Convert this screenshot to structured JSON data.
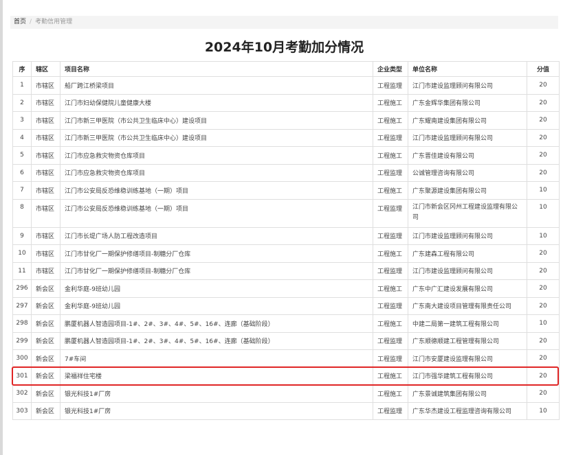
{
  "breadcrumb": {
    "home": "首页",
    "separator": "/",
    "current": "考勤信用管理"
  },
  "title": "2024年10月考勤加分情况",
  "table": {
    "headers": {
      "no": "序",
      "district": "辖区",
      "project": "项目名称",
      "type": "企业类型",
      "unit": "单位名称",
      "score": "分值"
    },
    "rows": [
      {
        "no": "1",
        "district": "市辖区",
        "project": "船厂跨江桥梁项目",
        "type": "工程监理",
        "unit": "江门市建设监理顾问有限公司",
        "score": "20"
      },
      {
        "no": "2",
        "district": "市辖区",
        "project": "江门市妇幼保健院儿童健康大楼",
        "type": "工程施工",
        "unit": "广东金辉华集团有限公司",
        "score": "20"
      },
      {
        "no": "3",
        "district": "市辖区",
        "project": "江门市新三甲医院（市公共卫生临床中心）建设项目",
        "type": "工程施工",
        "unit": "广东耀南建设集团有限公司",
        "score": "20"
      },
      {
        "no": "4",
        "district": "市辖区",
        "project": "江门市新三甲医院（市公共卫生临床中心）建设项目",
        "type": "工程监理",
        "unit": "江门市建设监理顾问有限公司",
        "score": "20"
      },
      {
        "no": "5",
        "district": "市辖区",
        "project": "江门市应急救灾物资仓库项目",
        "type": "工程施工",
        "unit": "广东晋佳建设有限公司",
        "score": "20"
      },
      {
        "no": "6",
        "district": "市辖区",
        "project": "江门市应急救灾物资仓库项目",
        "type": "工程监理",
        "unit": "公诚管理咨询有限公司",
        "score": "20"
      },
      {
        "no": "7",
        "district": "市辖区",
        "project": "江门市公安局反恐维稳训练基地（一期）项目",
        "type": "工程施工",
        "unit": "广东聚源建设集团有限公司",
        "score": "10"
      },
      {
        "no": "8",
        "district": "市辖区",
        "project": "江门市公安局反恐维稳训练基地（一期）项目",
        "type": "工程监理",
        "unit": "江门市新会区冈州工程建设监理有限公司",
        "score": "10"
      },
      {
        "no": "9",
        "district": "市辖区",
        "project": "江门市长堤广场人防工程改造项目",
        "type": "工程监理",
        "unit": "江门市建设监理顾问有限公司",
        "score": "10"
      },
      {
        "no": "10",
        "district": "市辖区",
        "project": "江门市甘化厂一期保护修缮项目-制糖分厂仓库",
        "type": "工程施工",
        "unit": "广东建森工程有限公司",
        "score": "20"
      },
      {
        "no": "11",
        "district": "市辖区",
        "project": "江门市甘化厂一期保护修缮项目-制糖分厂仓库",
        "type": "工程监理",
        "unit": "江门市建设监理顾问有限公司",
        "score": "20"
      },
      {
        "no": "296",
        "district": "新会区",
        "project": "金利华庭-9班幼儿园",
        "type": "工程施工",
        "unit": "广东中广汇建设发展有限公司",
        "score": "20"
      },
      {
        "no": "297",
        "district": "新会区",
        "project": "金利华庭-9班幼儿园",
        "type": "工程监理",
        "unit": "广东南大建设项目管理有限责任公司",
        "score": "20"
      },
      {
        "no": "298",
        "district": "新会区",
        "project": "鹏厦机器人智造园项目-1#、2#、3#、4#、5#、16#、连廊（基础阶段）",
        "type": "工程施工",
        "unit": "中建二局第一建筑工程有限公司",
        "score": "10"
      },
      {
        "no": "299",
        "district": "新会区",
        "project": "鹏厦机器人智造园项目-1#、2#、3#、4#、5#、16#、连廊（基础阶段）",
        "type": "工程监理",
        "unit": "广东顺德顺建工程管理有限公司",
        "score": "20"
      },
      {
        "no": "300",
        "district": "新会区",
        "project": "7#车间",
        "type": "工程监理",
        "unit": "江门市安厦建设监理有限公司",
        "score": "20"
      },
      {
        "no": "301",
        "district": "新会区",
        "project": "梁福祥住宅楼",
        "type": "工程施工",
        "unit": "江门市强华建筑工程有限公司",
        "score": "20"
      },
      {
        "no": "302",
        "district": "新会区",
        "project": "银光科技1#厂房",
        "type": "工程施工",
        "unit": "广东景诚建筑集团有限公司",
        "score": "20"
      },
      {
        "no": "303",
        "district": "新会区",
        "project": "银光科技1#厂房",
        "type": "工程监理",
        "unit": "广东华杰建设工程监理咨询有限公司",
        "score": "10"
      }
    ]
  },
  "highlight": {
    "row_no": "301",
    "color": "#e02424"
  }
}
